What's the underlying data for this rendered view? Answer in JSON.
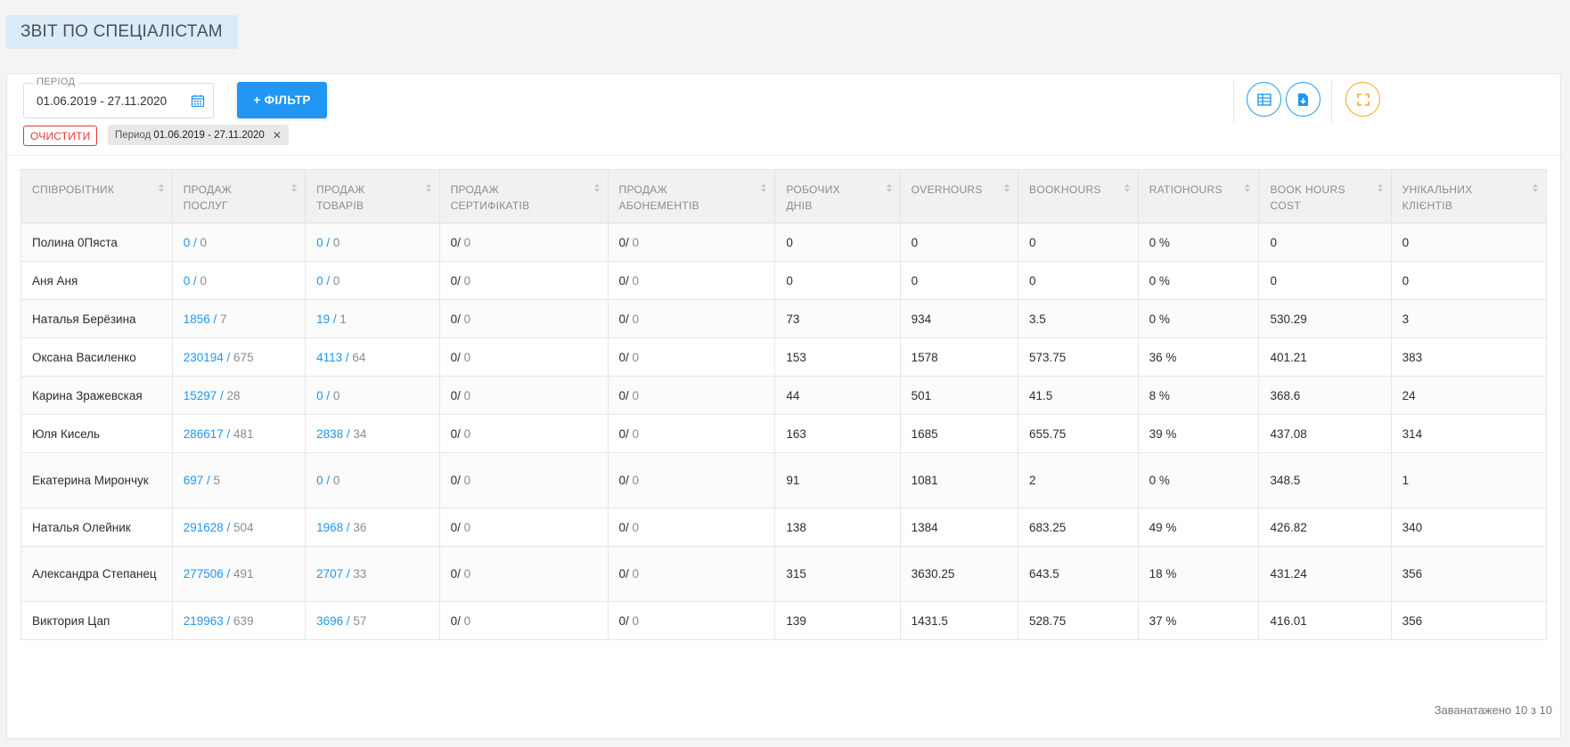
{
  "page": {
    "title": "ЗВІТ ПО СПЕЦІАЛІСТАМ"
  },
  "toolbar": {
    "period_label": "ПЕРІОД",
    "period_value": "01.06.2019 - 27.11.2020",
    "filter_label": "+ ФІЛЬТР",
    "clear_label": "ОЧИСТИТИ",
    "chip_prefix": "Период",
    "chip_value": "01.06.2019 - 27.11.2020",
    "chip_close": "✕"
  },
  "colors": {
    "accent": "#2196f3",
    "danger": "#e53935",
    "warning": "#f5a623"
  },
  "table": {
    "headers": [
      [
        "СПІВРОБІТНИК"
      ],
      [
        "ПРОДАЖ",
        "ПОСЛУГ"
      ],
      [
        "ПРОДАЖ",
        "ТОВАРІВ"
      ],
      [
        "ПРОДАЖ",
        "СЕРТИФІКАТІВ"
      ],
      [
        "ПРОДАЖ",
        "АБОНЕМЕНТІВ"
      ],
      [
        "РОБОЧИХ",
        "ДНІВ"
      ],
      [
        "OVERHOURS"
      ],
      [
        "BOOKHOURS"
      ],
      [
        "RATIOHOURS"
      ],
      [
        "BOOK HOURS",
        "COST"
      ],
      [
        "УНІКАЛЬНИХ",
        "КЛІЄНТІВ"
      ]
    ],
    "rows": [
      {
        "name": "Полина 0Пяста",
        "services": [
          "0",
          "0"
        ],
        "goods": [
          "0",
          "0"
        ],
        "certs": [
          "0",
          "0"
        ],
        "subs": [
          "0",
          "0"
        ],
        "days": "0",
        "overhours": "0",
        "bookhours": "0",
        "ratio": "0 %",
        "cost": "0",
        "clients": "0"
      },
      {
        "name": "Аня Аня",
        "services": [
          "0",
          "0"
        ],
        "goods": [
          "0",
          "0"
        ],
        "certs": [
          "0",
          "0"
        ],
        "subs": [
          "0",
          "0"
        ],
        "days": "0",
        "overhours": "0",
        "bookhours": "0",
        "ratio": "0 %",
        "cost": "0",
        "clients": "0"
      },
      {
        "name": "Наталья Берёзина",
        "services": [
          "1856",
          "7"
        ],
        "goods": [
          "19",
          "1"
        ],
        "certs": [
          "0",
          "0"
        ],
        "subs": [
          "0",
          "0"
        ],
        "days": "73",
        "overhours": "934",
        "bookhours": "3.5",
        "ratio": "0 %",
        "cost": "530.29",
        "clients": "3"
      },
      {
        "name": "Оксана Василенко",
        "services": [
          "230194",
          "675"
        ],
        "goods": [
          "4113",
          "64"
        ],
        "certs": [
          "0",
          "0"
        ],
        "subs": [
          "0",
          "0"
        ],
        "days": "153",
        "overhours": "1578",
        "bookhours": "573.75",
        "ratio": "36 %",
        "cost": "401.21",
        "clients": "383"
      },
      {
        "name": "Карина Зражевская",
        "services": [
          "15297",
          "28"
        ],
        "goods": [
          "0",
          "0"
        ],
        "certs": [
          "0",
          "0"
        ],
        "subs": [
          "0",
          "0"
        ],
        "days": "44",
        "overhours": "501",
        "bookhours": "41.5",
        "ratio": "8 %",
        "cost": "368.6",
        "clients": "24"
      },
      {
        "name": "Юля Кисель",
        "services": [
          "286617",
          "481"
        ],
        "goods": [
          "2838",
          "34"
        ],
        "certs": [
          "0",
          "0"
        ],
        "subs": [
          "0",
          "0"
        ],
        "days": "163",
        "overhours": "1685",
        "bookhours": "655.75",
        "ratio": "39 %",
        "cost": "437.08",
        "clients": "314"
      },
      {
        "name": "Екатерина Мирончук",
        "services": [
          "697",
          "5"
        ],
        "goods": [
          "0",
          "0"
        ],
        "certs": [
          "0",
          "0"
        ],
        "subs": [
          "0",
          "0"
        ],
        "days": "91",
        "overhours": "1081",
        "bookhours": "2",
        "ratio": "0 %",
        "cost": "348.5",
        "clients": "1"
      },
      {
        "name": "Наталья Олейник",
        "services": [
          "291628",
          "504"
        ],
        "goods": [
          "1968",
          "36"
        ],
        "certs": [
          "0",
          "0"
        ],
        "subs": [
          "0",
          "0"
        ],
        "days": "138",
        "overhours": "1384",
        "bookhours": "683.25",
        "ratio": "49 %",
        "cost": "426.82",
        "clients": "340"
      },
      {
        "name": "Александра Степанец",
        "services": [
          "277506",
          "491"
        ],
        "goods": [
          "2707",
          "33"
        ],
        "certs": [
          "0",
          "0"
        ],
        "subs": [
          "0",
          "0"
        ],
        "days": "315",
        "overhours": "3630.25",
        "bookhours": "643.5",
        "ratio": "18 %",
        "cost": "431.24",
        "clients": "356"
      },
      {
        "name": "Виктория Цап",
        "services": [
          "219963",
          "639"
        ],
        "goods": [
          "3696",
          "57"
        ],
        "certs": [
          "0",
          "0"
        ],
        "subs": [
          "0",
          "0"
        ],
        "days": "139",
        "overhours": "1431.5",
        "bookhours": "528.75",
        "ratio": "37 %",
        "cost": "416.01",
        "clients": "356"
      }
    ]
  },
  "footer": {
    "loaded": "Заванатажено 10 з 10"
  }
}
